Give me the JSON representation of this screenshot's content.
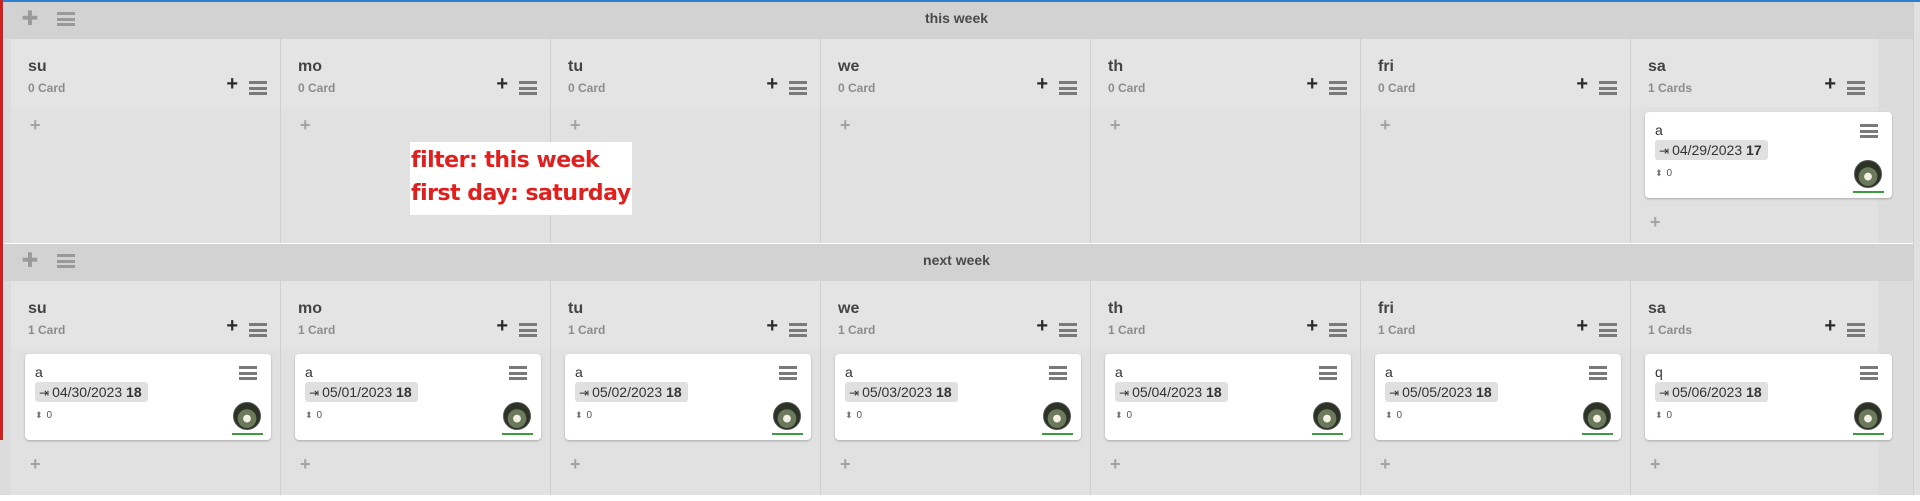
{
  "swimlanes": [
    {
      "title": "this week",
      "lists": [
        {
          "title": "su",
          "count": "0 Card",
          "cards": []
        },
        {
          "title": "mo",
          "count": "0 Card",
          "cards": []
        },
        {
          "title": "tu",
          "count": "0 Card",
          "cards": []
        },
        {
          "title": "we",
          "count": "0 Card",
          "cards": []
        },
        {
          "title": "th",
          "count": "0 Card",
          "cards": []
        },
        {
          "title": "fri",
          "count": "0 Card",
          "cards": []
        },
        {
          "title": "sa",
          "count": "1 Cards",
          "cards": [
            {
              "title": "a",
              "date": "04/29/2023",
              "day": "17",
              "votes": "0"
            }
          ]
        }
      ]
    },
    {
      "title": "next week",
      "lists": [
        {
          "title": "su",
          "count": "1 Card",
          "cards": [
            {
              "title": "a",
              "date": "04/30/2023",
              "day": "18",
              "votes": "0"
            }
          ]
        },
        {
          "title": "mo",
          "count": "1 Card",
          "cards": [
            {
              "title": "a",
              "date": "05/01/2023",
              "day": "18",
              "votes": "0"
            }
          ]
        },
        {
          "title": "tu",
          "count": "1 Card",
          "cards": [
            {
              "title": "a",
              "date": "05/02/2023",
              "day": "18",
              "votes": "0"
            }
          ]
        },
        {
          "title": "we",
          "count": "1 Card",
          "cards": [
            {
              "title": "a",
              "date": "05/03/2023",
              "day": "18",
              "votes": "0"
            }
          ]
        },
        {
          "title": "th",
          "count": "1 Card",
          "cards": [
            {
              "title": "a",
              "date": "05/04/2023",
              "day": "18",
              "votes": "0"
            }
          ]
        },
        {
          "title": "fri",
          "count": "1 Card",
          "cards": [
            {
              "title": "a",
              "date": "05/05/2023",
              "day": "18",
              "votes": "0"
            }
          ]
        },
        {
          "title": "sa",
          "count": "1 Cards",
          "cards": [
            {
              "title": "q",
              "date": "05/06/2023",
              "day": "18",
              "votes": "0"
            }
          ]
        }
      ]
    }
  ],
  "icons": {
    "lane_add": "plus-icon",
    "lane_menu": "hamburger-icon",
    "list_add": "plus-icon",
    "list_menu": "hamburger-icon",
    "add_card": "plus-icon",
    "card_menu": "hamburger-icon",
    "due_date": "sign-in-icon",
    "votes": "sort-icon",
    "member": "avatar"
  },
  "annotation": {
    "line1": "filter: this week",
    "line2": "first day: saturday"
  },
  "colors": {
    "annotation_text": "#e0201f",
    "frame_left": "#d01f1f",
    "frame_top": "#2f7fd1",
    "member_underline": "#3f9b3f"
  }
}
